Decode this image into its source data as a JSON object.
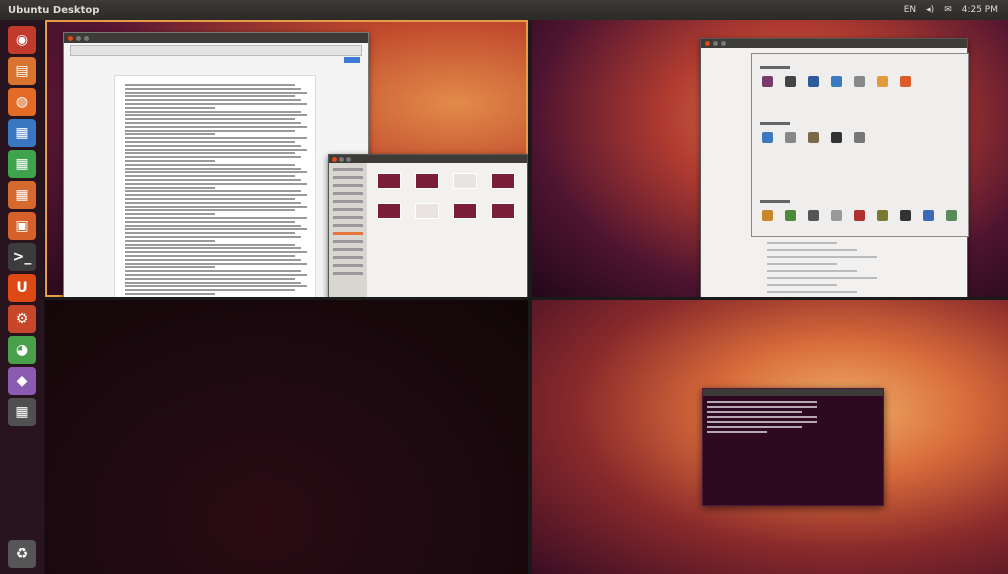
{
  "top_panel": {
    "title": "Ubuntu Desktop",
    "indicators": [
      "EN",
      "◂)",
      "✉",
      "4:25 PM"
    ]
  },
  "launcher": {
    "items": [
      {
        "name": "dash-home-icon",
        "glyph": "◉",
        "color": "#c23a2b"
      },
      {
        "name": "files-icon",
        "glyph": "▤",
        "color": "#d8742f"
      },
      {
        "name": "firefox-icon",
        "glyph": "◍",
        "color": "#e46b25"
      },
      {
        "name": "writer-icon",
        "glyph": "▦",
        "color": "#3a77c3"
      },
      {
        "name": "calc-icon",
        "glyph": "▦",
        "color": "#3fa34d"
      },
      {
        "name": "impress-icon",
        "glyph": "▦",
        "color": "#d6692e"
      },
      {
        "name": "software-center-icon",
        "glyph": "▣",
        "color": "#d5602a"
      },
      {
        "name": "terminal-icon",
        "glyph": ">_",
        "color": "#3c3c3c"
      },
      {
        "name": "ubuntu-one-icon",
        "glyph": "U",
        "color": "#dd4814"
      },
      {
        "name": "settings-icon",
        "glyph": "⚙",
        "color": "#c8472a"
      },
      {
        "name": "chrome-icon",
        "glyph": "◕",
        "color": "#4aa04a"
      },
      {
        "name": "app-icon",
        "glyph": "◆",
        "color": "#8a5bb0"
      },
      {
        "name": "workspace-switcher-icon",
        "glyph": "▦",
        "color": "#505050"
      }
    ],
    "trash_glyph": "♻"
  },
  "workspaces": [
    {
      "name": "workspace-1",
      "active": true
    },
    {
      "name": "workspace-2",
      "active": false
    },
    {
      "name": "workspace-3",
      "active": false
    },
    {
      "name": "workspace-4",
      "active": false
    }
  ],
  "colors": {
    "panel": "#3c3b37",
    "accent": "#e79c47",
    "close": "#df4a16",
    "terminal_bg": "#2d0922"
  }
}
